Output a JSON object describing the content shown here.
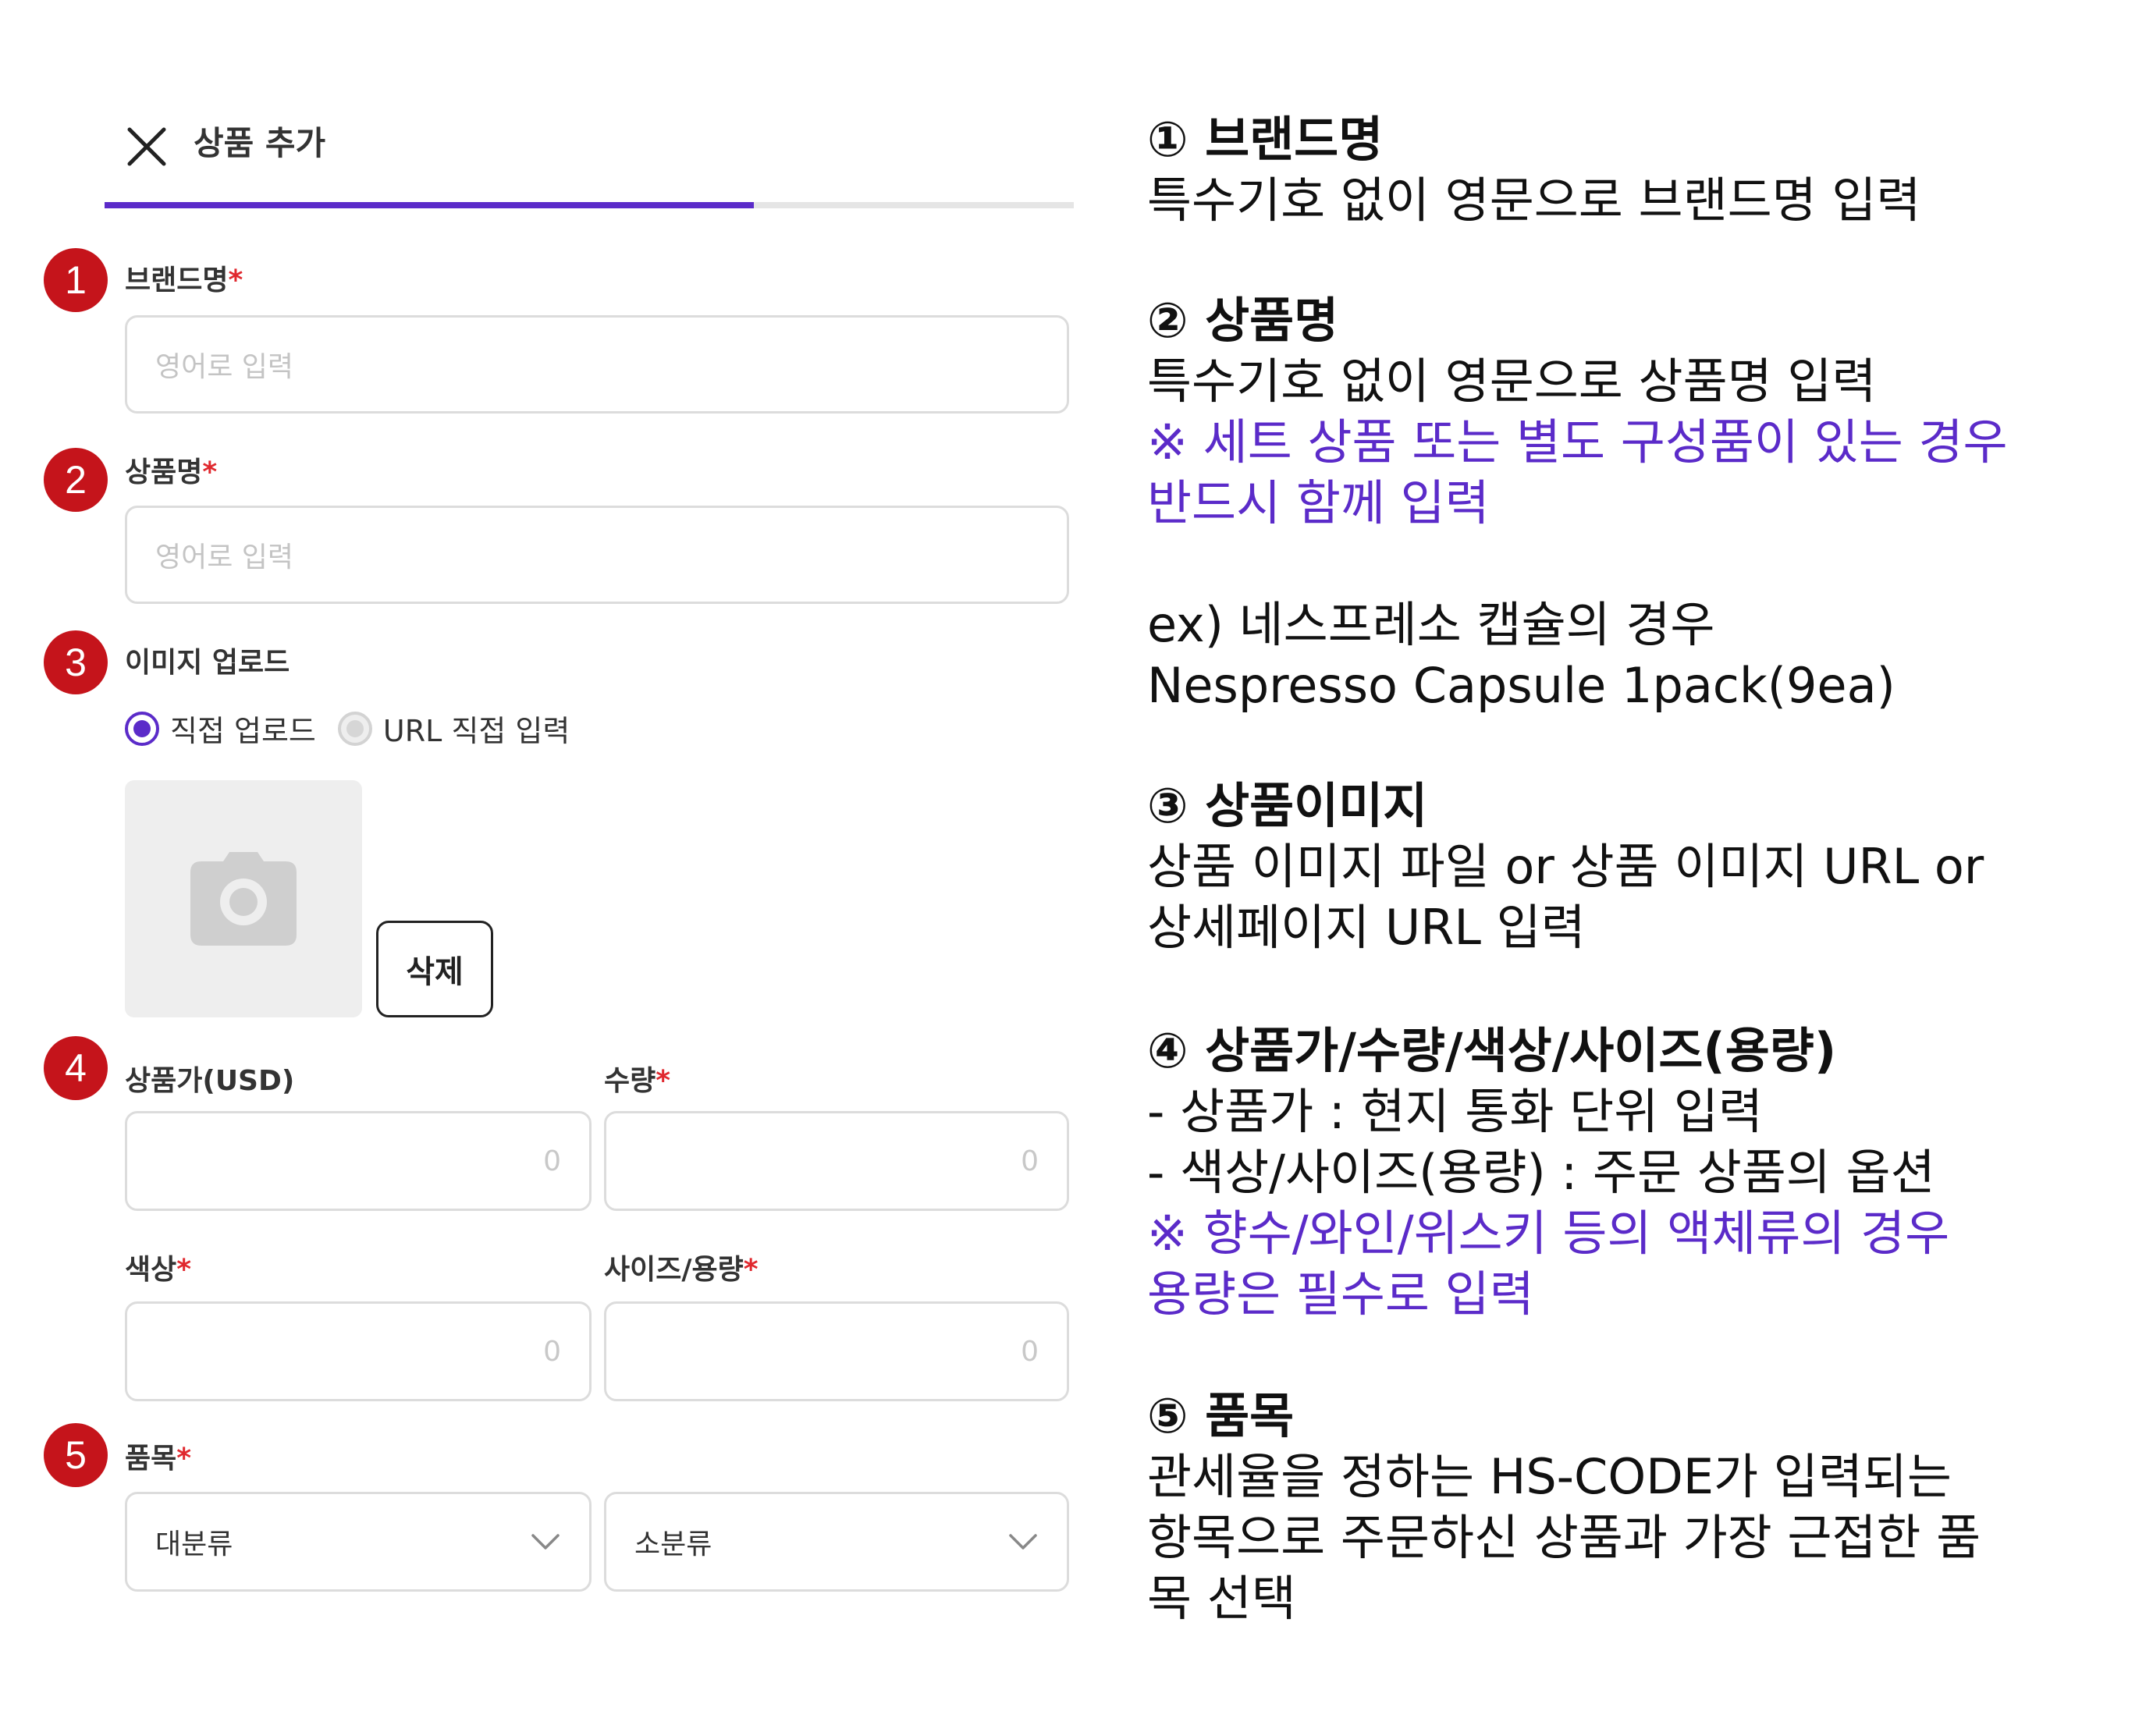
{
  "header": {
    "title": "상품 추가",
    "progress_fraction": 0.67
  },
  "form": {
    "brand": {
      "badge": "1",
      "label": "브랜드명",
      "required": "*",
      "placeholder": "영어로 입력"
    },
    "product_name": {
      "badge": "2",
      "label": "상품명",
      "required": "*",
      "placeholder": "영어로 입력"
    },
    "image_upload": {
      "badge": "3",
      "label": "이미지 업로드",
      "options": [
        "직접 업로드",
        "URL 직접 입력"
      ],
      "selected": "직접 업로드",
      "delete_label": "삭제"
    },
    "price": {
      "badge": "4",
      "label": "상품가(USD)",
      "placeholder": "0"
    },
    "quantity": {
      "label": "수량",
      "required": "*",
      "placeholder": "0"
    },
    "color": {
      "label": "색상",
      "required": "*",
      "placeholder": "0"
    },
    "size": {
      "label": "사이즈/용량",
      "required": "*",
      "placeholder": "0"
    },
    "category": {
      "badge": "5",
      "label": "품목",
      "required": "*",
      "major_value": "대분류",
      "minor_value": "소분류"
    }
  },
  "descriptions": {
    "s1": {
      "title": "① 브랜드명",
      "lines": [
        "특수기호 없이 영문으로 브랜드명 입력"
      ]
    },
    "s2": {
      "title": "② 상품명",
      "lines": [
        "특수기호 없이 영문으로 상품명 입력"
      ],
      "notes": [
        "※ 세트 상품 또는 별도 구성품이 있는 경우",
        "반드시 함께 입력"
      ],
      "example": [
        "ex) 네스프레소 캡슐의 경우",
        "Nespresso Capsule 1pack(9ea)"
      ]
    },
    "s3": {
      "title": "③  상품이미지",
      "lines": [
        "상품 이미지 파일 or 상품 이미지 URL or",
        "상세페이지 URL 입력"
      ]
    },
    "s4": {
      "title": "④ 상품가/수량/색상/사이즈(용량)",
      "lines": [
        "- 상품가 : 현지 통화 단위 입력",
        "- 색상/사이즈(용량) : 주문 상품의 옵션"
      ],
      "notes": [
        "※ 향수/와인/위스키 등의 액체류의 경우",
        "용량은 필수로 입력"
      ]
    },
    "s5": {
      "title": "⑤ 품목",
      "lines": [
        "관세율을 정하는 HS-CODE가 입력되는",
        "항목으로 주문하신 상품과 가장 근접한 품",
        "목 선택"
      ]
    }
  },
  "colors": {
    "accent": "#5b2bc9",
    "badge": "#c5141b",
    "required": "#e0282e"
  },
  "icons": [
    "close-icon",
    "camera-icon",
    "chevron-down-icon"
  ]
}
